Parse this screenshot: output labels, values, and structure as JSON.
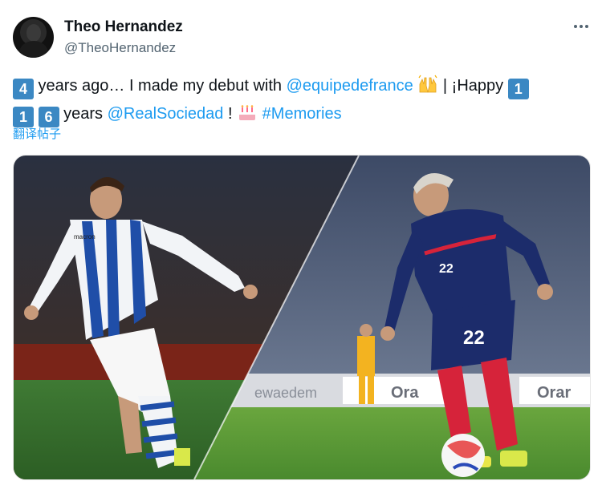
{
  "author": {
    "name": "Theo Hernandez",
    "handle": "@TheoHernandez"
  },
  "tweet": {
    "keycap_4": "4",
    "text_1": " years ago… I made my debut with ",
    "mention_1": "@equipedefrance",
    "text_2": " | ¡Happy ",
    "keycap_1a": "1",
    "keycap_1b": "1",
    "keycap_6": "6",
    "text_3": " years ",
    "mention_2": "@RealSociedad",
    "text_4": " ! ",
    "hashtag": "#Memories"
  },
  "translate_label": "翻译帖子",
  "media": {
    "left_jersey_text": "macron",
    "right_jersey_number": "22",
    "ad_board_left": "ewaedem",
    "ad_board_right_1": "Ora",
    "ad_board_right_2": "Orar"
  },
  "colors": {
    "link": "#1d9bf0",
    "keycap": "#3b88c3",
    "secondary_text": "#536471"
  },
  "icons": {
    "more": "more-horizontal-icon",
    "hands": "raising-hands-emoji",
    "cake": "birthday-cake-emoji"
  }
}
